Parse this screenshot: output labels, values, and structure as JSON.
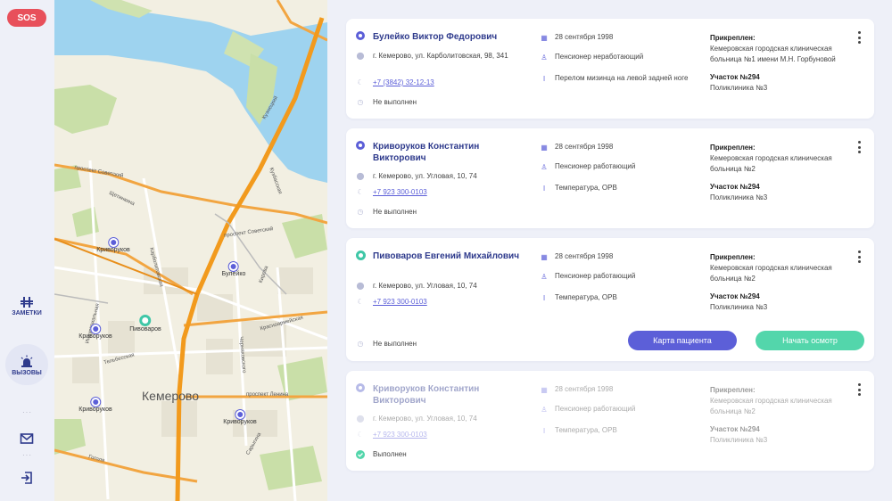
{
  "rail": {
    "sos": "SOS",
    "notes_label": "ЗАМЕТКИ",
    "calls_label": "ВЫЗОВЫ",
    "icons": [
      "notes-icon",
      "alarm-icon",
      "mail-icon",
      "logout-icon"
    ]
  },
  "map": {
    "city": "Кемерово",
    "streets": {
      "s1": "проспект Советский",
      "s2": "Щетинкина",
      "s3": "Карболитовская",
      "s4": "проспект Советский",
      "s5": "Кирова",
      "s6": "Индустриальная",
      "s7": "Тельбесская",
      "s8": "Красноармейская",
      "s9": "Черняховского",
      "s10": "проспект Ленина",
      "s11": "Гоголя",
      "s12": "Сарыгина",
      "s13": "Кузнецкий",
      "s14": "Кузбасская"
    },
    "pins": [
      {
        "label": "Криворуков"
      },
      {
        "label": "Булейко"
      },
      {
        "label": "Пивоваров"
      },
      {
        "label": "Криворуков"
      },
      {
        "label": "Криворуков"
      },
      {
        "label": "Криворуков"
      }
    ]
  },
  "cards": [
    {
      "name": "Булейко Виктор Федорович",
      "address": "г. Кемерово, ул. Карболитовская, 98, 341",
      "phone": "+7 (3842) 32-12-13",
      "status": "Не выполнен",
      "date": "28 сентября 1998",
      "category": "Пенсионер неработающий",
      "diagnosis": "Перелом мизинца на левой задней ноге",
      "attached_label": "Прикреплен:",
      "hospital": "Кемеровская городская клиническая больница №1 имени М.Н. Горбуновой",
      "area": "Участок №294",
      "clinic": "Поликлиника №3"
    },
    {
      "name": "Криворуков Константин Викторович",
      "address": "г. Кемерово, ул. Угловая, 10, 74",
      "phone": "+7 923 300-0103",
      "status": "Не выполнен",
      "date": "28 сентября 1998",
      "category": "Пенсионер работающий",
      "diagnosis": "Температура, ОРВ",
      "attached_label": "Прикреплен:",
      "hospital": "Кемеровская городская клиническая больница №2",
      "area": "Участок №294",
      "clinic": "Поликлиника №3"
    },
    {
      "name": "Пивоваров Евгений Михайлович",
      "address": "г. Кемерово, ул. Угловая, 10, 74",
      "phone": "+7 923 300-0103",
      "status": "Не выполнен",
      "date": "28 сентября 1998",
      "category": "Пенсионер работающий",
      "diagnosis": "Температура, ОРВ",
      "attached_label": "Прикреплен:",
      "hospital": "Кемеровская городская клиническая больница №2",
      "area": "Участок №294",
      "clinic": "Поликлиника №3",
      "btn_card": "Карта пациента",
      "btn_start": "Начать осмотр"
    },
    {
      "name": "Криворуков Константин Викторович",
      "address": "г. Кемерово, ул. Угловая, 10, 74",
      "phone": "+7 923 300-0103",
      "status": "Выполнен",
      "date": "28 сентября 1998",
      "category": "Пенсионер работающий",
      "diagnosis": "Температура, ОРВ",
      "attached_label": "Прикреплен:",
      "hospital": "Кемеровская городская клиническая больница №2",
      "area": "Участок №294",
      "clinic": "Поликлиника №3"
    }
  ],
  "colors": {
    "accent": "#5c5fd8",
    "success": "#53d6ab",
    "sos": "#e8505b",
    "name": "#2e3a8c"
  }
}
